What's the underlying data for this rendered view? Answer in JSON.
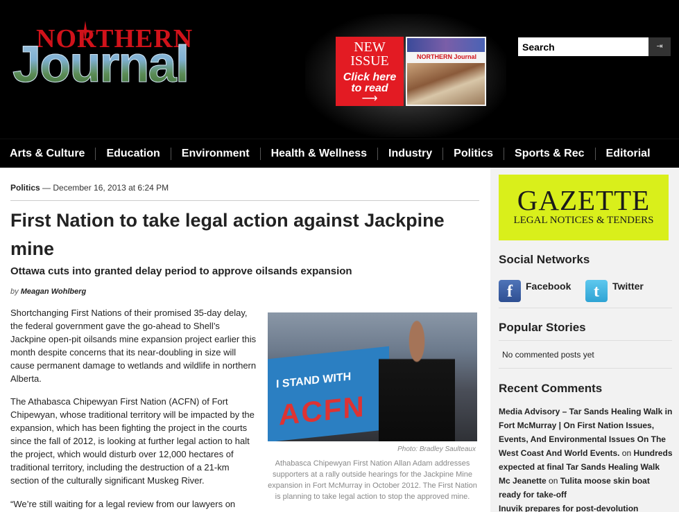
{
  "header": {
    "logo_top": "NORTHERN",
    "logo_bottom": "Journal",
    "issue_new": "NEW",
    "issue_word": "ISSUE",
    "issue_click": "Click here",
    "issue_read": "to read",
    "cover_masthead": "NORTHERN Journal",
    "search_placeholder": "Search",
    "search_button_glyph": "⇥"
  },
  "nav": {
    "items": [
      "Arts & Culture",
      "Education",
      "Environment",
      "Health & Wellness",
      "Industry",
      "Politics",
      "Sports & Rec",
      "Editorial"
    ]
  },
  "article": {
    "category": "Politics",
    "date": " — December 16, 2013 at 6:24 PM",
    "headline": "First Nation to take legal action against Jackpine mine",
    "subhead": "Ottawa cuts into granted delay period to approve oilsands expansion",
    "byline_prefix": "by ",
    "author": "Meagan Wohlberg",
    "paragraphs": [
      "Shortchanging First Nations of their promised 35-day delay, the federal government gave the go-ahead to Shell’s Jackpine open-pit oilsands mine expansion project earlier this month despite concerns that its near-doubling in size will cause permanent damage to wetlands and wildlife in northern Alberta.",
      "The Athabasca Chipewyan First Nation (ACFN) of Fort Chipewyan, whose traditional territory will be impacted by the expansion, which has been fighting the project in the courts since the fall of 2012, is looking at further legal action to halt the project, which would disturb over 12,000 hectares of traditional territory, including the destruction of a 21-km section of the culturally significant Muskeg River.",
      "“We’re still waiting for a legal review from our lawyers on"
    ],
    "photo_sign_line1": "I STAND WITH",
    "photo_sign_line2": "ACFN",
    "photo_credit": "Photo: Bradley Saulteaux",
    "caption": "Athabasca Chipewyan First Nation Allan Adam addresses supporters at a rally outside hearings for the Jackpine Mine expansion in Fort McMurray in October 2012. The First Nation is planning to take legal action to stop the approved mine."
  },
  "sidebar": {
    "gazette_title": "GAZETTE",
    "gazette_sub": "LEGAL NOTICES & TENDERS",
    "social_heading": "Social Networks",
    "facebook_label": "Facebook",
    "facebook_glyph": "f",
    "twitter_label": "Twitter",
    "twitter_glyph": "t",
    "popular_heading": "Popular Stories",
    "popular_empty": "No commented posts yet",
    "recent_heading": "Recent Comments",
    "recent": [
      {
        "author": "Media Advisory – Tar Sands Healing Walk in Fort McMurray | On First Nation Issues, Events, And Environmental Issues On The West Coast And World Events.",
        "on": " on ",
        "post": "Hundreds expected at final Tar Sands Healing Walk"
      },
      {
        "author": "Mc Jeanette",
        "on": " on ",
        "post": "Tulita moose skin boat ready for take-off"
      },
      {
        "author": "Inuvik prepares for post-devolution",
        "on": "",
        "post": ""
      }
    ]
  },
  "colors": {
    "header_bg": "#000000",
    "logo_red": "#d0121a",
    "gazette_bg": "#d9ef1b",
    "sidebar_bg": "#f2f2f2"
  }
}
